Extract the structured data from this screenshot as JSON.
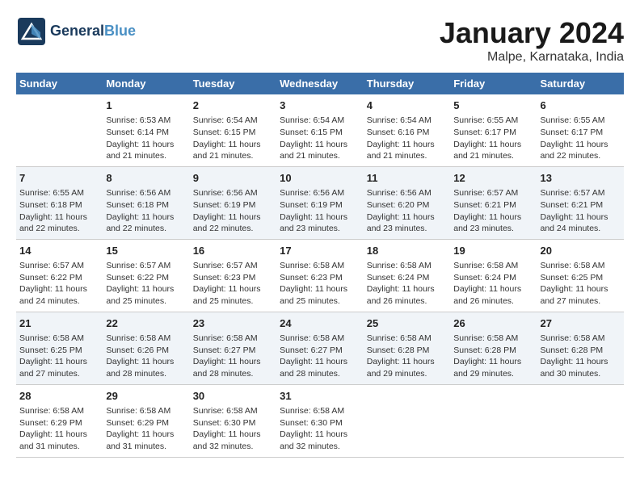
{
  "header": {
    "logo_line1": "General",
    "logo_line2": "Blue",
    "month": "January 2024",
    "location": "Malpe, Karnataka, India"
  },
  "days_of_week": [
    "Sunday",
    "Monday",
    "Tuesday",
    "Wednesday",
    "Thursday",
    "Friday",
    "Saturday"
  ],
  "weeks": [
    [
      {
        "day": "",
        "sunrise": "",
        "sunset": "",
        "daylight": ""
      },
      {
        "day": "1",
        "sunrise": "Sunrise: 6:53 AM",
        "sunset": "Sunset: 6:14 PM",
        "daylight": "Daylight: 11 hours and 21 minutes."
      },
      {
        "day": "2",
        "sunrise": "Sunrise: 6:54 AM",
        "sunset": "Sunset: 6:15 PM",
        "daylight": "Daylight: 11 hours and 21 minutes."
      },
      {
        "day": "3",
        "sunrise": "Sunrise: 6:54 AM",
        "sunset": "Sunset: 6:15 PM",
        "daylight": "Daylight: 11 hours and 21 minutes."
      },
      {
        "day": "4",
        "sunrise": "Sunrise: 6:54 AM",
        "sunset": "Sunset: 6:16 PM",
        "daylight": "Daylight: 11 hours and 21 minutes."
      },
      {
        "day": "5",
        "sunrise": "Sunrise: 6:55 AM",
        "sunset": "Sunset: 6:17 PM",
        "daylight": "Daylight: 11 hours and 21 minutes."
      },
      {
        "day": "6",
        "sunrise": "Sunrise: 6:55 AM",
        "sunset": "Sunset: 6:17 PM",
        "daylight": "Daylight: 11 hours and 22 minutes."
      }
    ],
    [
      {
        "day": "7",
        "sunrise": "Sunrise: 6:55 AM",
        "sunset": "Sunset: 6:18 PM",
        "daylight": "Daylight: 11 hours and 22 minutes."
      },
      {
        "day": "8",
        "sunrise": "Sunrise: 6:56 AM",
        "sunset": "Sunset: 6:18 PM",
        "daylight": "Daylight: 11 hours and 22 minutes."
      },
      {
        "day": "9",
        "sunrise": "Sunrise: 6:56 AM",
        "sunset": "Sunset: 6:19 PM",
        "daylight": "Daylight: 11 hours and 22 minutes."
      },
      {
        "day": "10",
        "sunrise": "Sunrise: 6:56 AM",
        "sunset": "Sunset: 6:19 PM",
        "daylight": "Daylight: 11 hours and 23 minutes."
      },
      {
        "day": "11",
        "sunrise": "Sunrise: 6:56 AM",
        "sunset": "Sunset: 6:20 PM",
        "daylight": "Daylight: 11 hours and 23 minutes."
      },
      {
        "day": "12",
        "sunrise": "Sunrise: 6:57 AM",
        "sunset": "Sunset: 6:21 PM",
        "daylight": "Daylight: 11 hours and 23 minutes."
      },
      {
        "day": "13",
        "sunrise": "Sunrise: 6:57 AM",
        "sunset": "Sunset: 6:21 PM",
        "daylight": "Daylight: 11 hours and 24 minutes."
      }
    ],
    [
      {
        "day": "14",
        "sunrise": "Sunrise: 6:57 AM",
        "sunset": "Sunset: 6:22 PM",
        "daylight": "Daylight: 11 hours and 24 minutes."
      },
      {
        "day": "15",
        "sunrise": "Sunrise: 6:57 AM",
        "sunset": "Sunset: 6:22 PM",
        "daylight": "Daylight: 11 hours and 25 minutes."
      },
      {
        "day": "16",
        "sunrise": "Sunrise: 6:57 AM",
        "sunset": "Sunset: 6:23 PM",
        "daylight": "Daylight: 11 hours and 25 minutes."
      },
      {
        "day": "17",
        "sunrise": "Sunrise: 6:58 AM",
        "sunset": "Sunset: 6:23 PM",
        "daylight": "Daylight: 11 hours and 25 minutes."
      },
      {
        "day": "18",
        "sunrise": "Sunrise: 6:58 AM",
        "sunset": "Sunset: 6:24 PM",
        "daylight": "Daylight: 11 hours and 26 minutes."
      },
      {
        "day": "19",
        "sunrise": "Sunrise: 6:58 AM",
        "sunset": "Sunset: 6:24 PM",
        "daylight": "Daylight: 11 hours and 26 minutes."
      },
      {
        "day": "20",
        "sunrise": "Sunrise: 6:58 AM",
        "sunset": "Sunset: 6:25 PM",
        "daylight": "Daylight: 11 hours and 27 minutes."
      }
    ],
    [
      {
        "day": "21",
        "sunrise": "Sunrise: 6:58 AM",
        "sunset": "Sunset: 6:25 PM",
        "daylight": "Daylight: 11 hours and 27 minutes."
      },
      {
        "day": "22",
        "sunrise": "Sunrise: 6:58 AM",
        "sunset": "Sunset: 6:26 PM",
        "daylight": "Daylight: 11 hours and 28 minutes."
      },
      {
        "day": "23",
        "sunrise": "Sunrise: 6:58 AM",
        "sunset": "Sunset: 6:27 PM",
        "daylight": "Daylight: 11 hours and 28 minutes."
      },
      {
        "day": "24",
        "sunrise": "Sunrise: 6:58 AM",
        "sunset": "Sunset: 6:27 PM",
        "daylight": "Daylight: 11 hours and 28 minutes."
      },
      {
        "day": "25",
        "sunrise": "Sunrise: 6:58 AM",
        "sunset": "Sunset: 6:28 PM",
        "daylight": "Daylight: 11 hours and 29 minutes."
      },
      {
        "day": "26",
        "sunrise": "Sunrise: 6:58 AM",
        "sunset": "Sunset: 6:28 PM",
        "daylight": "Daylight: 11 hours and 29 minutes."
      },
      {
        "day": "27",
        "sunrise": "Sunrise: 6:58 AM",
        "sunset": "Sunset: 6:28 PM",
        "daylight": "Daylight: 11 hours and 30 minutes."
      }
    ],
    [
      {
        "day": "28",
        "sunrise": "Sunrise: 6:58 AM",
        "sunset": "Sunset: 6:29 PM",
        "daylight": "Daylight: 11 hours and 31 minutes."
      },
      {
        "day": "29",
        "sunrise": "Sunrise: 6:58 AM",
        "sunset": "Sunset: 6:29 PM",
        "daylight": "Daylight: 11 hours and 31 minutes."
      },
      {
        "day": "30",
        "sunrise": "Sunrise: 6:58 AM",
        "sunset": "Sunset: 6:30 PM",
        "daylight": "Daylight: 11 hours and 32 minutes."
      },
      {
        "day": "31",
        "sunrise": "Sunrise: 6:58 AM",
        "sunset": "Sunset: 6:30 PM",
        "daylight": "Daylight: 11 hours and 32 minutes."
      },
      {
        "day": "",
        "sunrise": "",
        "sunset": "",
        "daylight": ""
      },
      {
        "day": "",
        "sunrise": "",
        "sunset": "",
        "daylight": ""
      },
      {
        "day": "",
        "sunrise": "",
        "sunset": "",
        "daylight": ""
      }
    ]
  ]
}
